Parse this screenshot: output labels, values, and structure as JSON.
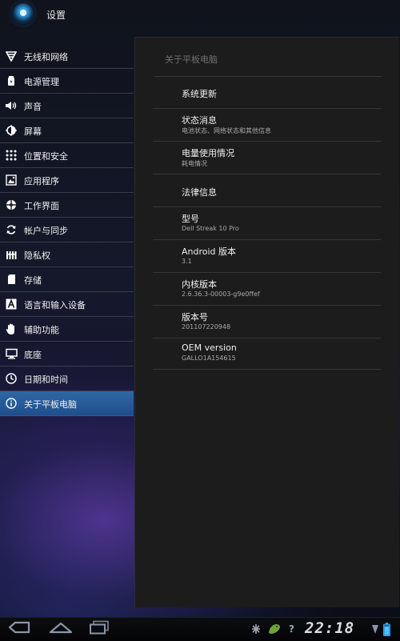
{
  "action_bar": {
    "title": "设置"
  },
  "sidebar": {
    "items": [
      {
        "label": "无线和网络",
        "icon": "wifi-icon"
      },
      {
        "label": "电源管理",
        "icon": "battery-icon"
      },
      {
        "label": "声音",
        "icon": "speaker-icon"
      },
      {
        "label": "屏幕",
        "icon": "brightness-icon"
      },
      {
        "label": "位置和安全",
        "icon": "pattern-lock-icon"
      },
      {
        "label": "应用程序",
        "icon": "applications-icon"
      },
      {
        "label": "工作界面",
        "icon": "workspace-icon"
      },
      {
        "label": "帐户与同步",
        "icon": "sync-icon"
      },
      {
        "label": "隐私权",
        "icon": "privacy-icon"
      },
      {
        "label": "存储",
        "icon": "sd-card-icon"
      },
      {
        "label": "语言和输入设备",
        "icon": "keyboard-letter-icon"
      },
      {
        "label": "辅助功能",
        "icon": "hand-icon"
      },
      {
        "label": "底座",
        "icon": "monitor-icon"
      },
      {
        "label": "日期和时间",
        "icon": "clock-icon"
      },
      {
        "label": "关于平板电脑",
        "icon": "info-icon"
      }
    ],
    "selected_index": 14
  },
  "content": {
    "header": "关于平板电脑",
    "rows": [
      {
        "title": "系统更新",
        "subtitle": ""
      },
      {
        "title": "状态消息",
        "subtitle": "电池状态、网络状态和其他信息"
      },
      {
        "title": "电量使用情况",
        "subtitle": "耗电情况"
      },
      {
        "title": "法律信息",
        "subtitle": ""
      },
      {
        "title": "型号",
        "subtitle": "Dell Streak 10 Pro"
      },
      {
        "title": "Android 版本",
        "subtitle": "3.1"
      },
      {
        "title": "内核版本",
        "subtitle": "2.6.36.3-00003-g9e0ffef"
      },
      {
        "title": "版本号",
        "subtitle": "201107220948"
      },
      {
        "title": "OEM version",
        "subtitle": "GALLO1A154615"
      }
    ]
  },
  "system_bar": {
    "clock": "22:18",
    "nav": [
      "back-icon",
      "home-icon",
      "recent-apps-icon"
    ],
    "status_icons": [
      "debug-icon",
      "android-icon",
      "unknown-icon",
      "signal-icon",
      "battery-status-icon"
    ],
    "unknown_text": "?"
  },
  "colors": {
    "selected": "#2f67a6",
    "panel": "#1c1c1c",
    "accent": "#33b5e5"
  }
}
